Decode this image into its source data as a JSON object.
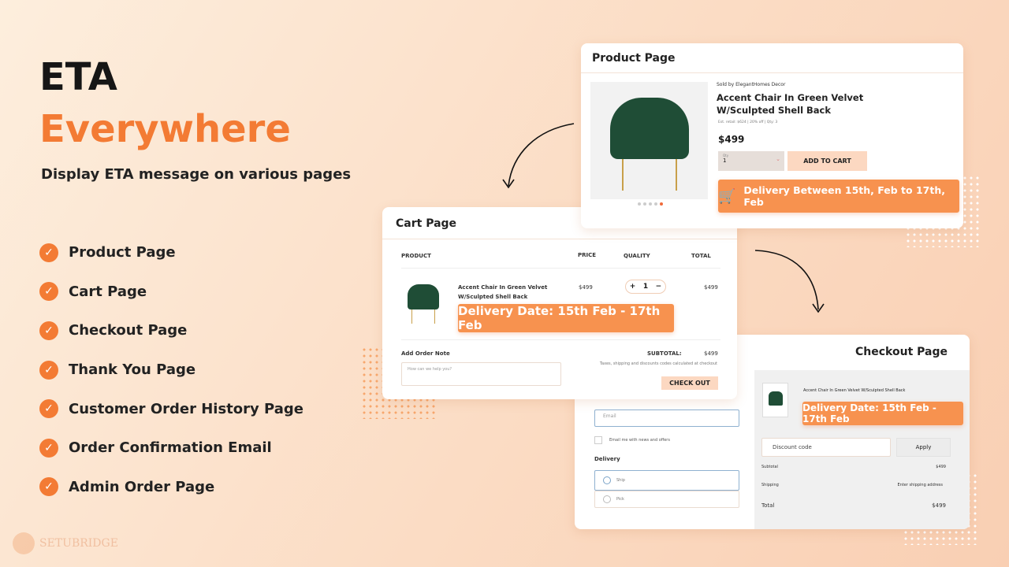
{
  "hero": {
    "title_line1": "ETA",
    "title_line2": "Everywhere",
    "subtitle": "Display ETA message on various pages"
  },
  "features": [
    "Product Page",
    "Cart Page",
    "Checkout Page",
    "Thank You Page",
    "Customer Order History Page",
    "Order Confirmation Email",
    "Admin Order Page"
  ],
  "brand": {
    "name": "SETUBRIDGE"
  },
  "colors": {
    "accent": "#f37b34",
    "eta_badge": "#f7924f",
    "peach_button": "#fcd8c1"
  },
  "product_page": {
    "title": "Product Page",
    "seller": "Sold by ElegantHomes Decor",
    "product_name": "Accent Chair In Green Velvet W/Sculpted Shell Back",
    "meta": "Est. retail: $624  |  20% off  |  Qty: 3",
    "price": "$499",
    "qty_label": "Qty",
    "qty_value": "1",
    "add_to_cart": "ADD TO CART",
    "eta": "Delivery Between 15th, Feb to 17th, Feb"
  },
  "cart_page": {
    "title": "Cart Page",
    "headers": [
      "PRODUCT",
      "PRICE",
      "QUALITY",
      "TOTAL"
    ],
    "item": {
      "name": "Accent Chair In Green Velvet W/Sculpted Shell Back",
      "price": "$499",
      "qty": "1",
      "total": "$499"
    },
    "eta": "Delivery Date: 15th Feb - 17th Feb",
    "note_label": "Add Order Note",
    "note_placeholder": "How can we help you?",
    "subtotal_label": "SUBTOTAL:",
    "subtotal": "$499",
    "tax_note": "Taxes, shipping and discounts codes calculated at checkout",
    "checkout": "CHECK OUT"
  },
  "checkout_page": {
    "title": "Checkout Page",
    "email_placeholder": "Email",
    "newsletter": "Email me with news and offers",
    "delivery_label": "Delivery",
    "options": [
      "Ship",
      "Pick"
    ],
    "item_name": "Accent Chair In Green Velvet  W/Sculpted Shell Back",
    "eta": "Delivery Date: 15th Feb - 17th Feb",
    "discount_placeholder": "Discount code",
    "apply": "Apply",
    "subtotal_label": "Subtotal",
    "subtotal": "$499",
    "shipping_label": "Shipping",
    "shipping_value": "Enter shipping address",
    "total_label": "Total",
    "total": "$499"
  }
}
